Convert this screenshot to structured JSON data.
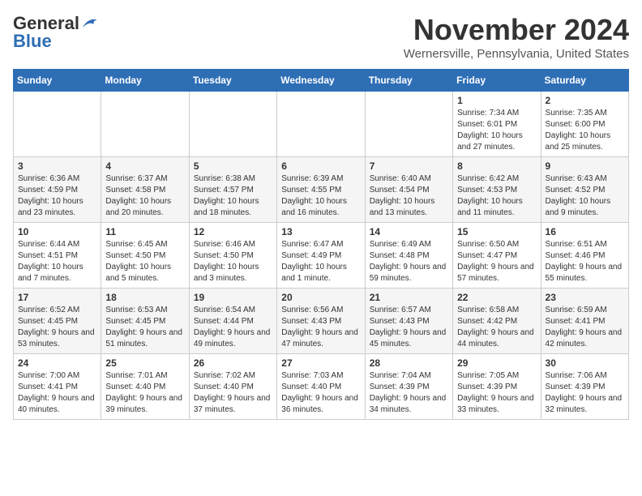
{
  "logo": {
    "line1": "General",
    "line2": "Blue"
  },
  "header": {
    "month": "November 2024",
    "location": "Wernersville, Pennsylvania, United States"
  },
  "days_of_week": [
    "Sunday",
    "Monday",
    "Tuesday",
    "Wednesday",
    "Thursday",
    "Friday",
    "Saturday"
  ],
  "weeks": [
    [
      {
        "day": "",
        "info": ""
      },
      {
        "day": "",
        "info": ""
      },
      {
        "day": "",
        "info": ""
      },
      {
        "day": "",
        "info": ""
      },
      {
        "day": "",
        "info": ""
      },
      {
        "day": "1",
        "info": "Sunrise: 7:34 AM\nSunset: 6:01 PM\nDaylight: 10 hours and 27 minutes."
      },
      {
        "day": "2",
        "info": "Sunrise: 7:35 AM\nSunset: 6:00 PM\nDaylight: 10 hours and 25 minutes."
      }
    ],
    [
      {
        "day": "3",
        "info": "Sunrise: 6:36 AM\nSunset: 4:59 PM\nDaylight: 10 hours and 23 minutes."
      },
      {
        "day": "4",
        "info": "Sunrise: 6:37 AM\nSunset: 4:58 PM\nDaylight: 10 hours and 20 minutes."
      },
      {
        "day": "5",
        "info": "Sunrise: 6:38 AM\nSunset: 4:57 PM\nDaylight: 10 hours and 18 minutes."
      },
      {
        "day": "6",
        "info": "Sunrise: 6:39 AM\nSunset: 4:55 PM\nDaylight: 10 hours and 16 minutes."
      },
      {
        "day": "7",
        "info": "Sunrise: 6:40 AM\nSunset: 4:54 PM\nDaylight: 10 hours and 13 minutes."
      },
      {
        "day": "8",
        "info": "Sunrise: 6:42 AM\nSunset: 4:53 PM\nDaylight: 10 hours and 11 minutes."
      },
      {
        "day": "9",
        "info": "Sunrise: 6:43 AM\nSunset: 4:52 PM\nDaylight: 10 hours and 9 minutes."
      }
    ],
    [
      {
        "day": "10",
        "info": "Sunrise: 6:44 AM\nSunset: 4:51 PM\nDaylight: 10 hours and 7 minutes."
      },
      {
        "day": "11",
        "info": "Sunrise: 6:45 AM\nSunset: 4:50 PM\nDaylight: 10 hours and 5 minutes."
      },
      {
        "day": "12",
        "info": "Sunrise: 6:46 AM\nSunset: 4:50 PM\nDaylight: 10 hours and 3 minutes."
      },
      {
        "day": "13",
        "info": "Sunrise: 6:47 AM\nSunset: 4:49 PM\nDaylight: 10 hours and 1 minute."
      },
      {
        "day": "14",
        "info": "Sunrise: 6:49 AM\nSunset: 4:48 PM\nDaylight: 9 hours and 59 minutes."
      },
      {
        "day": "15",
        "info": "Sunrise: 6:50 AM\nSunset: 4:47 PM\nDaylight: 9 hours and 57 minutes."
      },
      {
        "day": "16",
        "info": "Sunrise: 6:51 AM\nSunset: 4:46 PM\nDaylight: 9 hours and 55 minutes."
      }
    ],
    [
      {
        "day": "17",
        "info": "Sunrise: 6:52 AM\nSunset: 4:45 PM\nDaylight: 9 hours and 53 minutes."
      },
      {
        "day": "18",
        "info": "Sunrise: 6:53 AM\nSunset: 4:45 PM\nDaylight: 9 hours and 51 minutes."
      },
      {
        "day": "19",
        "info": "Sunrise: 6:54 AM\nSunset: 4:44 PM\nDaylight: 9 hours and 49 minutes."
      },
      {
        "day": "20",
        "info": "Sunrise: 6:56 AM\nSunset: 4:43 PM\nDaylight: 9 hours and 47 minutes."
      },
      {
        "day": "21",
        "info": "Sunrise: 6:57 AM\nSunset: 4:43 PM\nDaylight: 9 hours and 45 minutes."
      },
      {
        "day": "22",
        "info": "Sunrise: 6:58 AM\nSunset: 4:42 PM\nDaylight: 9 hours and 44 minutes."
      },
      {
        "day": "23",
        "info": "Sunrise: 6:59 AM\nSunset: 4:41 PM\nDaylight: 9 hours and 42 minutes."
      }
    ],
    [
      {
        "day": "24",
        "info": "Sunrise: 7:00 AM\nSunset: 4:41 PM\nDaylight: 9 hours and 40 minutes."
      },
      {
        "day": "25",
        "info": "Sunrise: 7:01 AM\nSunset: 4:40 PM\nDaylight: 9 hours and 39 minutes."
      },
      {
        "day": "26",
        "info": "Sunrise: 7:02 AM\nSunset: 4:40 PM\nDaylight: 9 hours and 37 minutes."
      },
      {
        "day": "27",
        "info": "Sunrise: 7:03 AM\nSunset: 4:40 PM\nDaylight: 9 hours and 36 minutes."
      },
      {
        "day": "28",
        "info": "Sunrise: 7:04 AM\nSunset: 4:39 PM\nDaylight: 9 hours and 34 minutes."
      },
      {
        "day": "29",
        "info": "Sunrise: 7:05 AM\nSunset: 4:39 PM\nDaylight: 9 hours and 33 minutes."
      },
      {
        "day": "30",
        "info": "Sunrise: 7:06 AM\nSunset: 4:39 PM\nDaylight: 9 hours and 32 minutes."
      }
    ]
  ]
}
